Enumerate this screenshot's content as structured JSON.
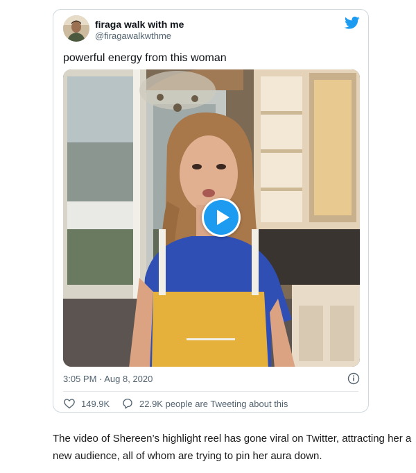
{
  "tweet": {
    "display_name": "firaga walk with me",
    "handle": "@firagawalkwthme",
    "text": "powerful energy from this woman",
    "timestamp": "3:05 PM · Aug 8, 2020",
    "likes": "149.9K",
    "tweeting_about": "22.9K people are Tweeting about this"
  },
  "icons": {
    "logo": "twitter-bird-icon",
    "play": "play-icon",
    "info": "info-icon",
    "like": "heart-icon",
    "reply": "speech-bubble-icon"
  },
  "colors": {
    "twitter_blue": "#1d9bf0",
    "secondary_text": "#536471",
    "border": "#cfd9de"
  },
  "article": {
    "line1": "The video of Shereen’s highlight reel has gone viral on Twitter, attracting her a",
    "line2": "new audience, all of whom are trying to pin her aura down."
  }
}
